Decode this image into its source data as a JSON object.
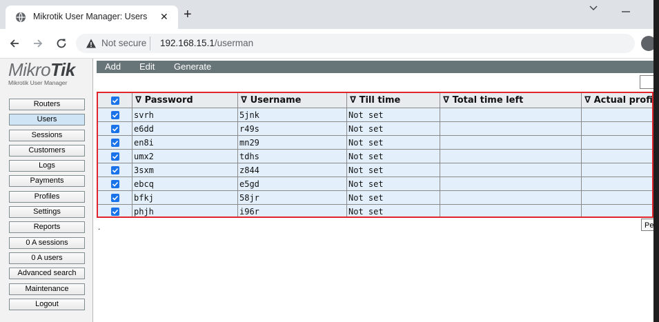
{
  "browser": {
    "tab_title": "Mikrotik User Manager: Users",
    "new_tab_label": "+",
    "security_label": "Not secure",
    "url_host": "192.168.15.1",
    "url_path": "/userman"
  },
  "sidebar": {
    "logo_light": "Mikro",
    "logo_bold": "Tik",
    "logo_subtitle": "Mikrotik User Manager",
    "items": [
      {
        "label": "Routers"
      },
      {
        "label": "Users"
      },
      {
        "label": "Sessions"
      },
      {
        "label": "Customers"
      },
      {
        "label": "Logs"
      },
      {
        "label": "Payments"
      },
      {
        "label": "Profiles"
      },
      {
        "label": "Settings"
      },
      {
        "label": "Reports"
      },
      {
        "label": "0 A sessions"
      },
      {
        "label": "0 A users"
      },
      {
        "label": "Advanced search"
      },
      {
        "label": "Maintenance"
      },
      {
        "label": "Logout"
      }
    ],
    "active_item": "Users"
  },
  "actions": {
    "add": "Add",
    "edit": "Edit",
    "generate": "Generate"
  },
  "table": {
    "columns": [
      "∇ Password",
      "∇ Username",
      "∇ Till time",
      "∇ Total time left",
      "∇ Actual profile"
    ],
    "rows": [
      {
        "password": "svrh",
        "username": "5jnk",
        "till_time": "Not set",
        "total_time_left": "",
        "actual_profile": ""
      },
      {
        "password": "e6dd",
        "username": "r49s",
        "till_time": "Not set",
        "total_time_left": "",
        "actual_profile": ""
      },
      {
        "password": "en8i",
        "username": "mn29",
        "till_time": "Not set",
        "total_time_left": "",
        "actual_profile": ""
      },
      {
        "password": "umx2",
        "username": "tdhs",
        "till_time": "Not set",
        "total_time_left": "",
        "actual_profile": ""
      },
      {
        "password": "3sxm",
        "username": "z844",
        "till_time": "Not set",
        "total_time_left": "",
        "actual_profile": ""
      },
      {
        "password": "ebcq",
        "username": "e5gd",
        "till_time": "Not set",
        "total_time_left": "",
        "actual_profile": ""
      },
      {
        "password": "bfkj",
        "username": "58jr",
        "till_time": "Not set",
        "total_time_left": "",
        "actual_profile": ""
      },
      {
        "password": "phjh",
        "username": "i96r",
        "till_time": "Not set",
        "total_time_left": "",
        "actual_profile": ""
      }
    ]
  },
  "footer": {
    "dot": ".",
    "page_button": "Pe"
  },
  "colors": {
    "action_bar": "#687578",
    "row_background": "#e3f0fb",
    "highlight_border": "#e0242b",
    "checkbox": "#1a73e8"
  }
}
